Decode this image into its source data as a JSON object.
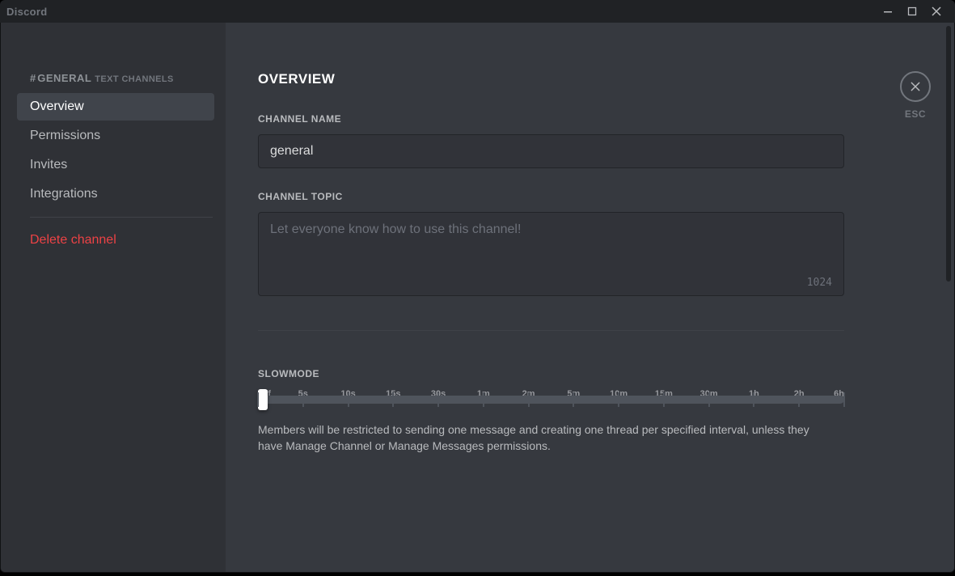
{
  "window": {
    "title": "Discord"
  },
  "sidebar": {
    "hash": "#",
    "channel_name": "GENERAL",
    "category_label": "TEXT CHANNELS",
    "items": [
      {
        "label": "Overview",
        "selected": true,
        "danger": false
      },
      {
        "label": "Permissions",
        "selected": false,
        "danger": false
      },
      {
        "label": "Invites",
        "selected": false,
        "danger": false
      },
      {
        "label": "Integrations",
        "selected": false,
        "danger": false
      }
    ],
    "delete_label": "Delete channel"
  },
  "main": {
    "title": "OVERVIEW",
    "channel_name_label": "CHANNEL NAME",
    "channel_name_value": "general",
    "channel_topic_label": "CHANNEL TOPIC",
    "channel_topic_value": "",
    "channel_topic_placeholder": "Let everyone know how to use this channel!",
    "channel_topic_remaining": "1024",
    "slowmode_label": "SLOWMODE",
    "slowmode_ticks": [
      "Off",
      "5s",
      "10s",
      "15s",
      "30s",
      "1m",
      "2m",
      "5m",
      "10m",
      "15m",
      "30m",
      "1h",
      "2h",
      "6h"
    ],
    "slowmode_description": "Members will be restricted to sending one message and creating one thread per specified interval, unless they have Manage Channel or Manage Messages permissions."
  },
  "close": {
    "esc_label": "ESC"
  }
}
